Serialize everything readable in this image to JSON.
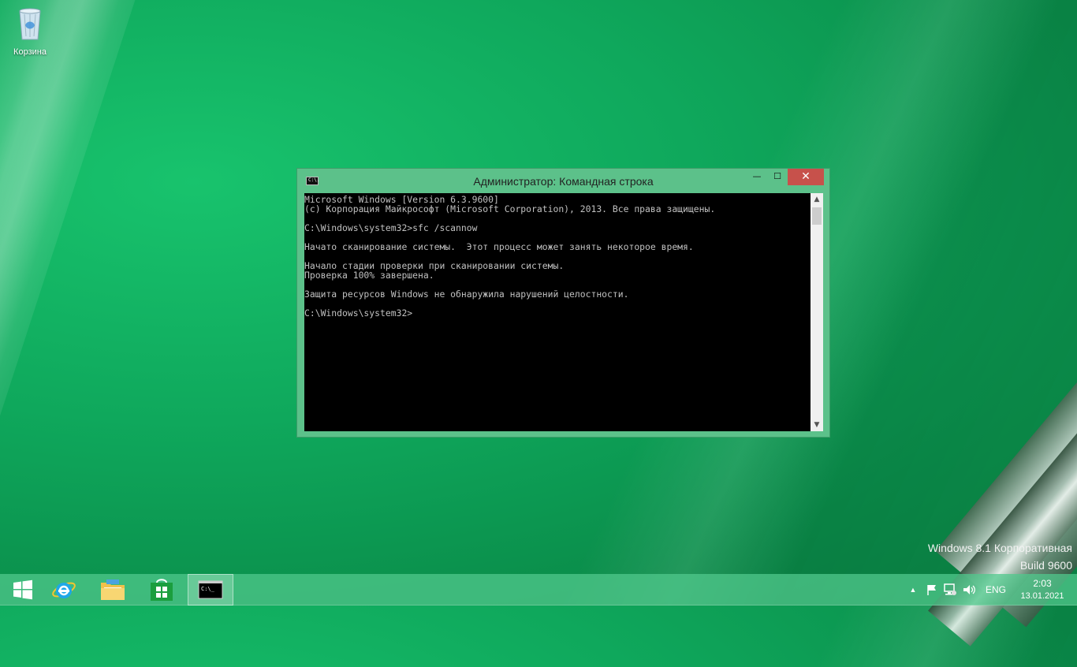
{
  "desktop": {
    "recycle_bin_label": "Корзина"
  },
  "window": {
    "title": "Администратор: Командная строка",
    "icon_text": "C:\\.",
    "minimize_symbol": "—",
    "maximize_symbol": "☐",
    "close_symbol": "✕",
    "console_lines": [
      "Microsoft Windows [Version 6.3.9600]",
      "(c) Корпорация Майкрософт (Microsoft Corporation), 2013. Все права защищены.",
      "",
      "C:\\Windows\\system32>sfc /scannow",
      "",
      "Начато сканирование системы.  Этот процесс может занять некоторое время.",
      "",
      "Начало стадии проверки при сканировании системы.",
      "Проверка 100% завершена.",
      "",
      "Защита ресурсов Windows не обнаружила нарушений целостности.",
      "",
      "C:\\Windows\\system32>"
    ]
  },
  "watermark": {
    "line1": "Windows 8.1 Корпоративная",
    "line2": "Build 9600"
  },
  "taskbar": {
    "apps": [
      {
        "name": "start",
        "icon": "windows-logo-icon"
      },
      {
        "name": "internet-explorer",
        "icon": "internet-explorer-icon"
      },
      {
        "name": "file-explorer",
        "icon": "folder-icon"
      },
      {
        "name": "store",
        "icon": "store-icon"
      },
      {
        "name": "command-prompt",
        "icon": "cmd-icon",
        "active": true
      }
    ],
    "tray": {
      "language": "ENG",
      "time": "2:03",
      "date": "13.01.2021"
    }
  },
  "colors": {
    "window_frame": "#5cc18a",
    "close_button": "#c7514b",
    "console_bg": "#000000",
    "console_text": "#c0c0c0"
  }
}
